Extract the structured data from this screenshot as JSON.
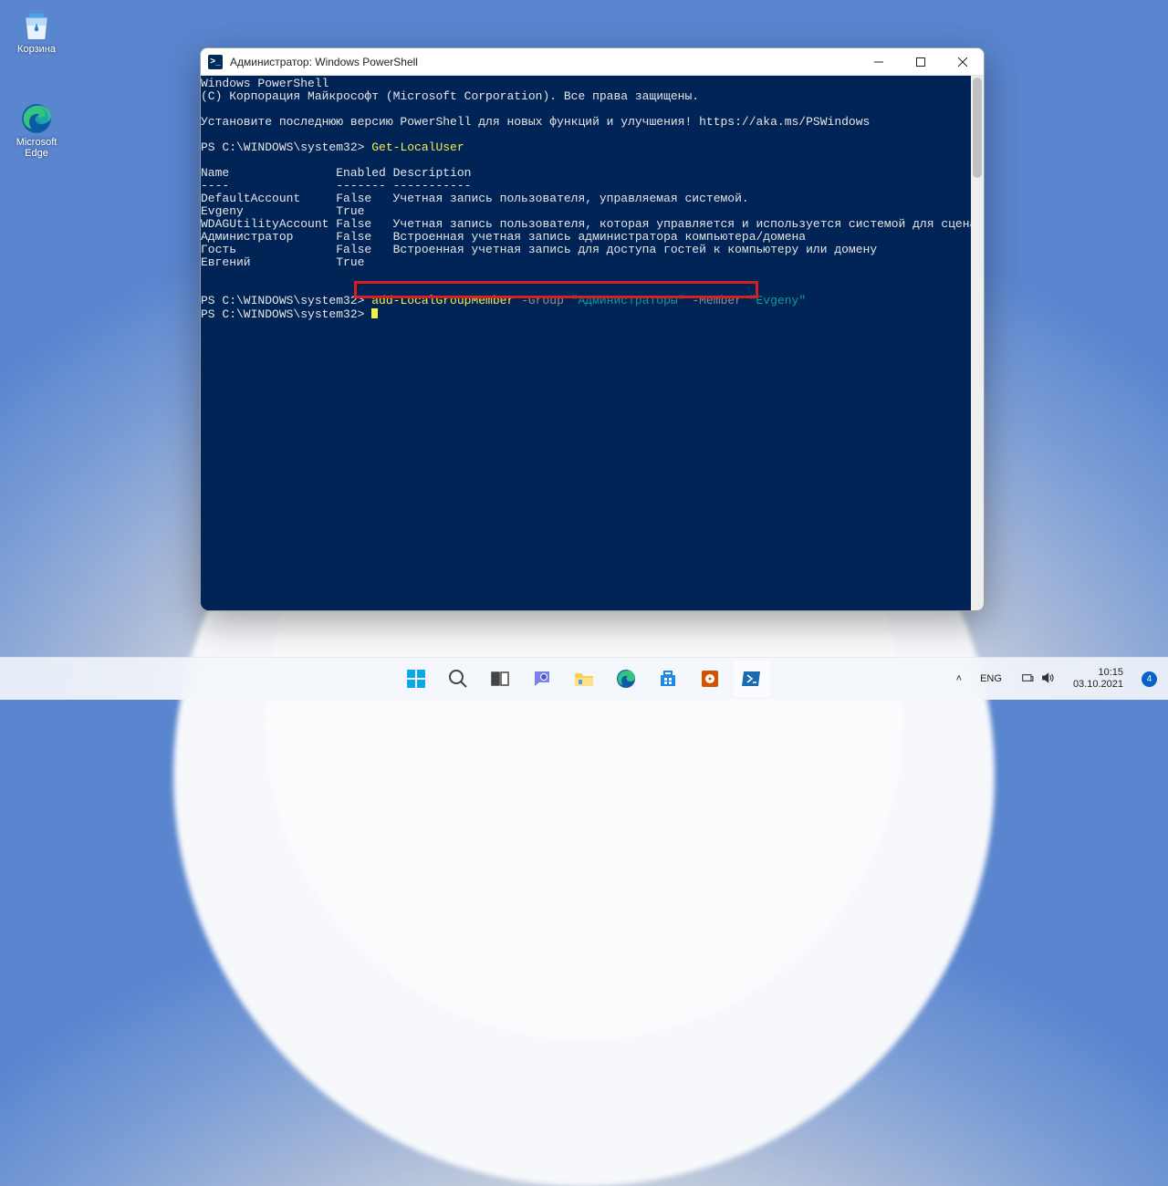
{
  "desktop": {
    "icons": [
      {
        "label": "Корзина",
        "name": "recycle-bin-icon"
      },
      {
        "label": "Microsoft Edge",
        "name": "microsoft-edge-icon"
      }
    ]
  },
  "window": {
    "title": "Администратор: Windows PowerShell",
    "ps_icon_glyph": ">_"
  },
  "terminal": {
    "header_line1": "Windows PowerShell",
    "header_line2": "(С) Корпорация Майкрософт (Microsoft Corporation). Все права защищены.",
    "install_msg": "Установите последнюю версию PowerShell для новых функций и улучшения! https://aka.ms/PSWindows",
    "prompt1_prefix": "PS C:\\WINDOWS\\system32> ",
    "prompt1_cmd": "Get-LocalUser",
    "table_header": "Name               Enabled Description",
    "table_divider": "----               ------- -----------",
    "rows": [
      "DefaultAccount     False   Учетная запись пользователя, управляемая системой.",
      "Evgeny             True",
      "WDAGUtilityAccount False   Учетная запись пользователя, которая управляется и используется системой для сценариев Ap...",
      "Администратор      False   Встроенная учетная запись администратора компьютера/домена",
      "Гость              False   Встроенная учетная запись для доступа гостей к компьютеру или домену",
      "Евгений            True"
    ],
    "prompt2_prefix": "PS C:\\WINDOWS\\system32> ",
    "cmd2_cmdlet": "add-LocalGroupMember",
    "cmd2_param1": " -Group ",
    "cmd2_arg1": "\"Администраторы\"",
    "cmd2_param2": " -Member ",
    "cmd2_arg2": "\"Evgeny\"",
    "prompt3_prefix": "PS C:\\WINDOWS\\system32> "
  },
  "taskbar": {
    "items": [
      {
        "name": "start-button"
      },
      {
        "name": "search-button"
      },
      {
        "name": "task-view-button"
      },
      {
        "name": "chat-button"
      },
      {
        "name": "file-explorer-button"
      },
      {
        "name": "edge-button"
      },
      {
        "name": "store-button"
      },
      {
        "name": "groove-button"
      },
      {
        "name": "powershell-button"
      }
    ],
    "tray": {
      "chevron": "˄",
      "lang": "ENG",
      "time": "10:15",
      "date": "03.10.2021",
      "notif_count": "4"
    }
  }
}
